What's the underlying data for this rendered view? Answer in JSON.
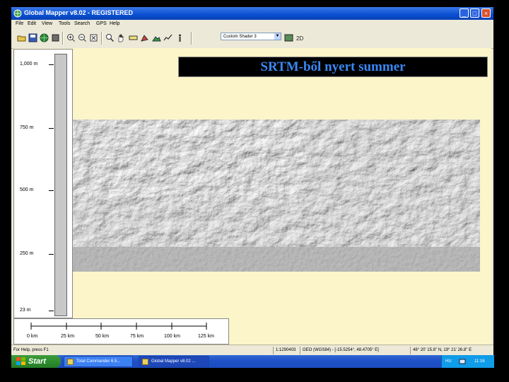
{
  "window": {
    "title": "Global Mapper v8.02 - REGISTERED",
    "controls": {
      "minimize": "_",
      "maximize": "□",
      "close": "×"
    }
  },
  "menu": [
    "File",
    "Edit",
    "View",
    "Tools",
    "Search",
    "GPS",
    "Help"
  ],
  "toolbar": {
    "icons": [
      "open-icon",
      "save-icon",
      "globe-icon",
      "layers-icon",
      "zoom-in-icon",
      "zoom-out-icon",
      "full-view-icon",
      "zoom-tool-icon",
      "pan-tool-icon",
      "measure-icon",
      "digitizer-icon",
      "3d-view-icon",
      "path-profile-icon",
      "info-tool-icon"
    ],
    "shader_select": "Custom Shader 3"
  },
  "banner": {
    "text": "SRTM-ből nyert summer",
    "color": "#3a87f4"
  },
  "elevation_legend": {
    "labels": [
      "1,000 m",
      "750 m",
      "500 m",
      "250 m",
      "23 m"
    ]
  },
  "scale_bar": {
    "labels": [
      "0 km",
      "25 km",
      "50 km",
      "75 km",
      "100 km",
      "125 km"
    ]
  },
  "status": {
    "help": "For Help, press F1",
    "scale": "1:1290403",
    "projection": "GEO (WGS84) - [-15.5254°, 48.4705° E]",
    "coords": "48° 20' 15.8\" N, 19° 21' 26.8\" E"
  },
  "taskbar": {
    "start": "Start",
    "tasks": [
      "Total Commander 6.5...",
      "Global Mapper v8.02 ..."
    ],
    "tray_lang": "HU",
    "clock": "11:16"
  },
  "colors": {
    "titlebar": "#0a4fd2",
    "mapview": "#fbf5c9",
    "taskbar": "#1f52c7",
    "start": "#2f8f2f"
  }
}
